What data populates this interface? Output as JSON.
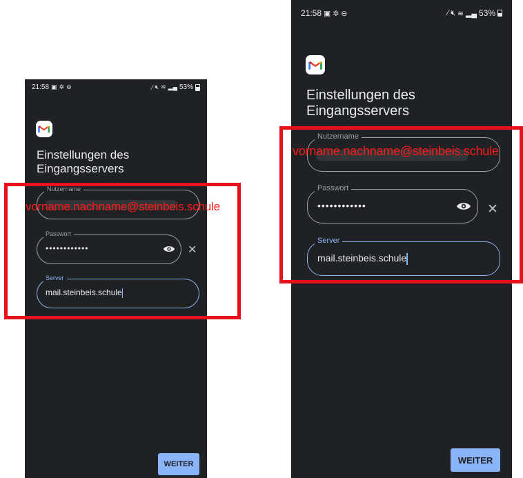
{
  "status_bar": {
    "time": "21:58",
    "left_icons": [
      "calendar-icon",
      "pinwheel-icon",
      "do-not-disturb-icon"
    ],
    "battery": "53%"
  },
  "screen": {
    "app_logo": "gmail-logo",
    "title_line1": "Einstellungen des",
    "title_line2": "Eingangsservers",
    "username": {
      "label": "Nutzername"
    },
    "password": {
      "label": "Passwort",
      "value": "••••••••••••"
    },
    "server": {
      "label": "Server",
      "value": "mail.steinbeis.schule"
    },
    "next_button": "WEITER"
  },
  "annotation": {
    "text": "vorname.nachname@steinbeis.schule",
    "color": "#e8101b"
  },
  "theme": {
    "background": "#202124",
    "accent": "#8ab4f8",
    "text": "#e8eaed"
  }
}
